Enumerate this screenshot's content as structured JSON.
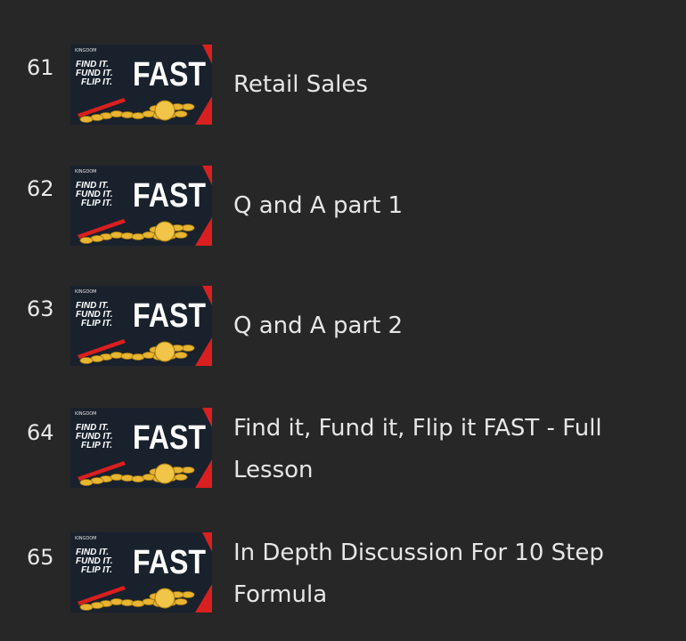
{
  "thumbnail": {
    "line1": "FIND IT.",
    "line2": "FUND IT.",
    "line3": "FLIP IT.",
    "big": "FAST",
    "corner": "KINGDOM",
    "colors": {
      "background": "#1f2a3a",
      "accent": "#d91f1f",
      "coin": "#e8b530"
    }
  },
  "lessons": [
    {
      "number": "61",
      "title": "Retail Sales"
    },
    {
      "number": "62",
      "title": "Q and A part 1"
    },
    {
      "number": "63",
      "title": "Q and A part 2"
    },
    {
      "number": "64",
      "title": "Find it, Fund it, Flip it FAST - Full Lesson"
    },
    {
      "number": "65",
      "title": "In Depth Discussion For 10 Step Formula"
    }
  ]
}
